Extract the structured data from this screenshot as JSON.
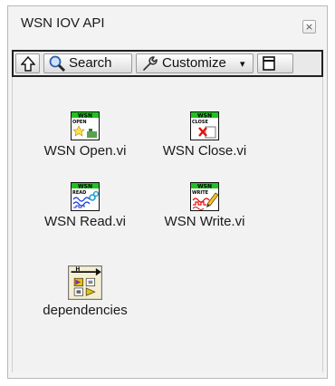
{
  "window": {
    "title": "WSN IOV API",
    "close_glyph": "×"
  },
  "toolbar": {
    "up_icon": "up-arrow-icon",
    "search_label": "Search",
    "customize_label": "Customize",
    "customize_arrow": "▾"
  },
  "items": [
    {
      "label": "WSN Open.vi",
      "icon": "wsn-open-vi-icon",
      "badge": "WSN",
      "tag": "OPEN"
    },
    {
      "label": "WSN Close.vi",
      "icon": "wsn-close-vi-icon",
      "badge": "WSN",
      "tag": "CLOSE"
    },
    {
      "label": "WSN Read.vi",
      "icon": "wsn-read-vi-icon",
      "badge": "WSN",
      "tag": "READ"
    },
    {
      "label": "WSN Write.vi",
      "icon": "wsn-write-vi-icon",
      "badge": "WSN",
      "tag": "WRITE"
    },
    {
      "label": "dependencies",
      "icon": "dependencies-folder-icon"
    }
  ],
  "colors": {
    "badge_green": "#1fc21f",
    "frame": "#b9b9b9",
    "toolbar_border": "#222222"
  }
}
